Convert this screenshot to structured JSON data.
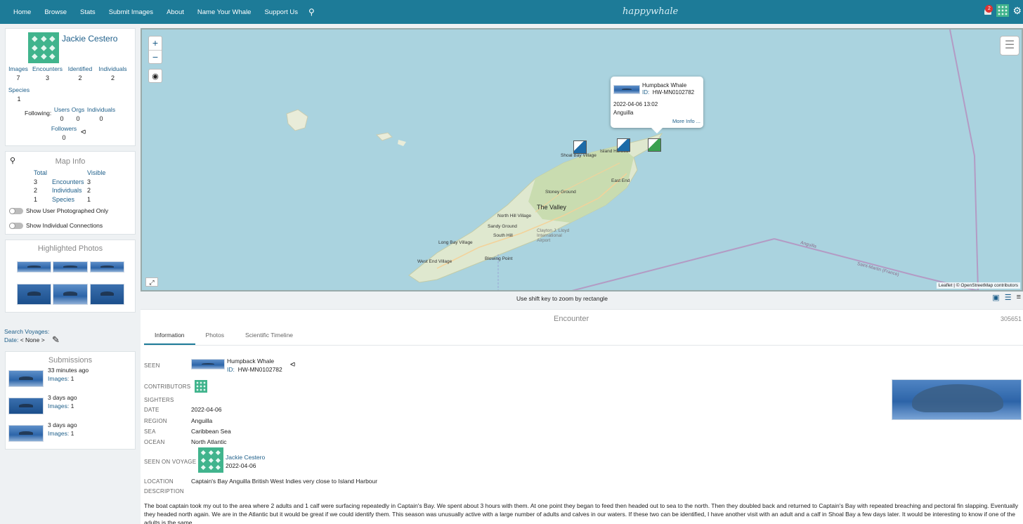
{
  "nav": {
    "items": [
      "Home",
      "Browse",
      "Stats",
      "Submit Images",
      "About",
      "Name Your Whale",
      "Support Us"
    ],
    "logo": "happywhale",
    "notification_count": "2"
  },
  "profile": {
    "name": "Jackie Cestero",
    "stats": [
      {
        "label": "Images",
        "value": "7"
      },
      {
        "label": "Encounters",
        "value": "3"
      },
      {
        "label": "Identified",
        "value": "2"
      },
      {
        "label": "Individuals",
        "value": "2"
      },
      {
        "label": "Species",
        "value": "1"
      }
    ],
    "following_label": "Following:",
    "following": [
      {
        "label": "Users",
        "value": "0"
      },
      {
        "label": "Orgs",
        "value": "0"
      },
      {
        "label": "Individuals",
        "value": "0"
      }
    ],
    "followers_label": "Followers",
    "followers_value": "0"
  },
  "map_info": {
    "title": "Map Info",
    "col_total": "Total",
    "col_visible": "Visible",
    "rows": [
      {
        "total": "3",
        "label": "Encounters",
        "visible": "3"
      },
      {
        "total": "2",
        "label": "Individuals",
        "visible": "2"
      },
      {
        "total": "1",
        "label": "Species",
        "visible": "1"
      }
    ],
    "toggle_user_photographed": "Show User Photographed Only",
    "toggle_connections": "Show Individual Connections"
  },
  "highlights": {
    "title": "Highlighted Photos"
  },
  "voyages": {
    "label": "Search Voyages:",
    "date_label": "Date:",
    "date_value": "< None >"
  },
  "submissions": {
    "title": "Submissions",
    "items": [
      {
        "time": "33 minutes ago",
        "images_label": "Images:",
        "images": "1"
      },
      {
        "time": "3 days ago",
        "images_label": "Images:",
        "images": "1"
      },
      {
        "time": "3 days ago",
        "images_label": "Images:",
        "images": "1"
      }
    ]
  },
  "map": {
    "popup": {
      "species": "Humpback Whale",
      "id_label": "ID:",
      "id": "HW-MN0102782",
      "datetime": "2022-04-06 13:02",
      "region": "Anguilla",
      "more": "More Info ..."
    },
    "labels": {
      "the_valley": "The Valley",
      "shoal_bay": "Shoal Bay Village",
      "island_harbour": "Island Harbour",
      "east_end": "East End",
      "stoney_ground": "Stoney Ground",
      "north_hill": "North Hill Village",
      "sandy_ground": "Sandy Ground",
      "south_hill": "South Hill",
      "long_bay": "Long Bay Village",
      "west_end": "West End Village",
      "blowing_point": "Blowing Point",
      "airport": "Clayton J. Lloyd International Airport",
      "sea_anguilla": "Anguilla",
      "sea_stmartin": "Saint-Martin (France)"
    },
    "attribution": "Leaflet | © OpenStreetMap contributors",
    "zoom_hint": "Use shift key to zoom by rectangle"
  },
  "encounter": {
    "title": "Encounter",
    "id": "305651",
    "tabs": [
      "Information",
      "Photos",
      "Scientific Timeline"
    ],
    "labels": {
      "seen": "SEEN",
      "contributors": "CONTRIBUTORS",
      "sighters": "SIGHTERS",
      "date": "DATE",
      "region": "REGION",
      "sea": "SEA",
      "ocean": "OCEAN",
      "seen_on_voyage": "SEEN ON VOYAGE",
      "location": "LOCATION",
      "description": "DESCRIPTION"
    },
    "seen_species": "Humpback Whale",
    "seen_id_label": "ID:",
    "seen_id": "HW-MN0102782",
    "date": "2022-04-06",
    "region": "Anguilla",
    "sea": "Caribbean Sea",
    "ocean": "North Atlantic",
    "voyage_name": "Jackie Cestero",
    "voyage_date": "2022-04-06",
    "location": "Captain's Bay Anguilla British West Indies very close to Island Harbour",
    "description": "The boat captain took my out to the area where 2 adults and 1 calf were surfacing repeatedly in Captain's Bay. We spent about 3 hours with them. At one point they began to feed then headed out to sea to the north. Then they doubled back and returned to Captain's Bay with repeated breaching and pectoral fin slapping. Eventually they headed north again. We are in the Atlantic but it would be great if we could identify them. This season was unusually active with a large number of adults and calves in our waters. If these two can be identified, I have another visit with an adult and a calf in Shoal Bay a few days later. It would be interesting to know if one of the adults is the same."
  }
}
